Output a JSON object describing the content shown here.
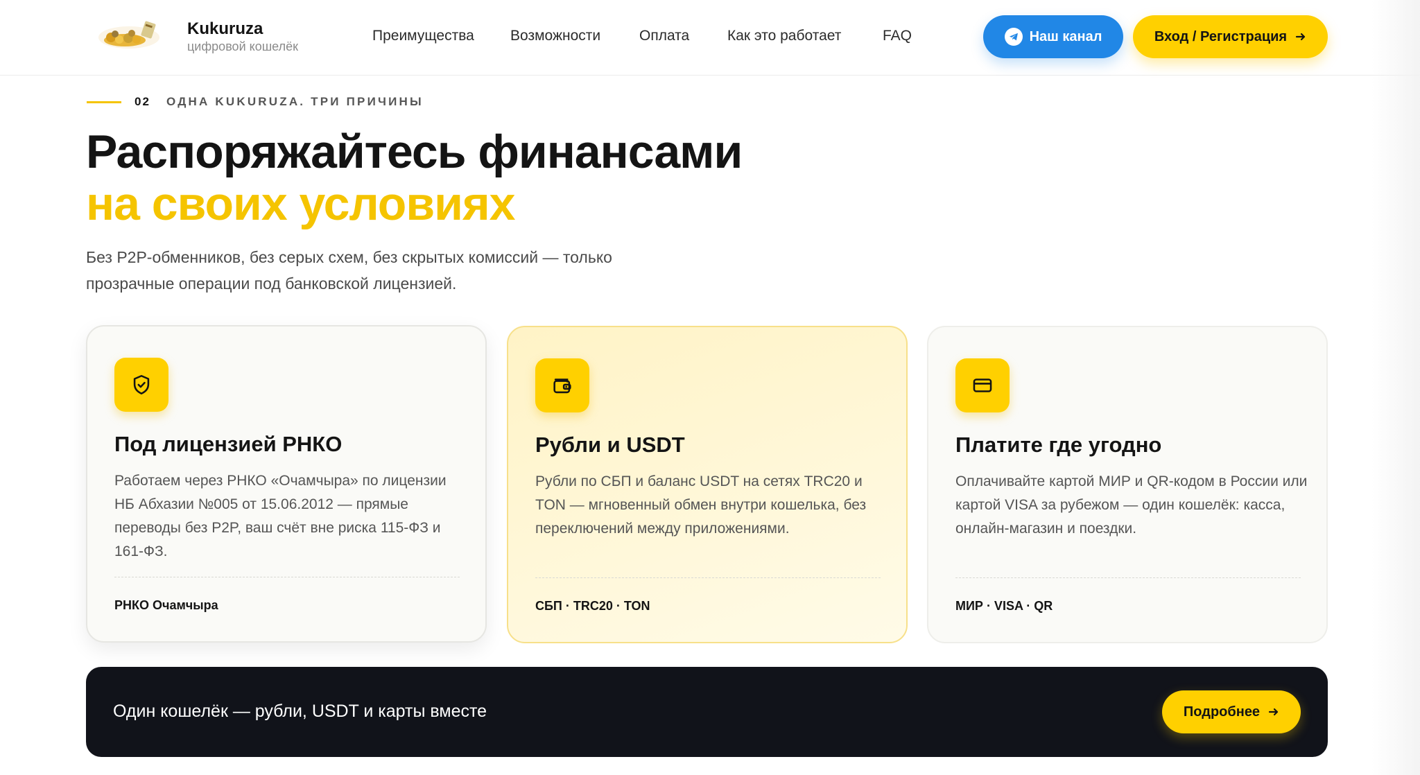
{
  "header": {
    "brand_name": "Kukuruza",
    "brand_subtitle": "цифровой кошелёк",
    "nav": [
      {
        "label": "Преимущества"
      },
      {
        "label": "Возможности"
      },
      {
        "label": "Оплата"
      },
      {
        "label": "Как это работает"
      },
      {
        "label": "FAQ"
      }
    ],
    "channel_button": {
      "label": "Наш канал",
      "icon": "telegram-icon"
    },
    "login_button": {
      "label": "Вход / Регистрация",
      "icon": "arrow-right-icon"
    }
  },
  "section": {
    "number": "02",
    "eyebrow": "ОДНА KUKURUZA. ТРИ ПРИЧИНЫ",
    "headline_line1": "Распоряжайтесь финансами",
    "headline_line2": "на своих условиях",
    "lead": "Без P2P-обменников, без серых схем, без скрытых комиссий — только прозрачные операции под банковской лицензией."
  },
  "cards": [
    {
      "icon": "shield-check-icon",
      "title": "Под лицензией РНКО",
      "description": "Работаем через РНКО «Очамчыра» по лицензии НБ Абхазии №005 от 15.06.2012 — прямые переводы без P2P, ваш счёт вне риска 115-ФЗ и 161-ФЗ.",
      "tag": "РНКО Очамчыра"
    },
    {
      "icon": "wallet-icon",
      "title": "Рубли и USDT",
      "description": "Рубли по СБП и баланс USDT на сетях TRC20 и TON — мгновенный обмен внутри кошелька, без переключений между приложениями.",
      "tag": "СБП · TRC20 · TON"
    },
    {
      "icon": "credit-card-icon",
      "title": "Платите где угодно",
      "description": "Оплачивайте картой МИР и QR-кодом в России или картой VISA за рубежом — один кошелёк: касса, онлайн-магазин и поездки.",
      "tag": "МИР · VISA · QR"
    }
  ],
  "banner": {
    "text": "Один кошелёк — рубли, USDT и карты вместе",
    "button_label": "Подробнее"
  },
  "colors": {
    "accent_yellow": "#ffd000",
    "accent_blue": "#2187e6",
    "dark": "#11131a"
  }
}
